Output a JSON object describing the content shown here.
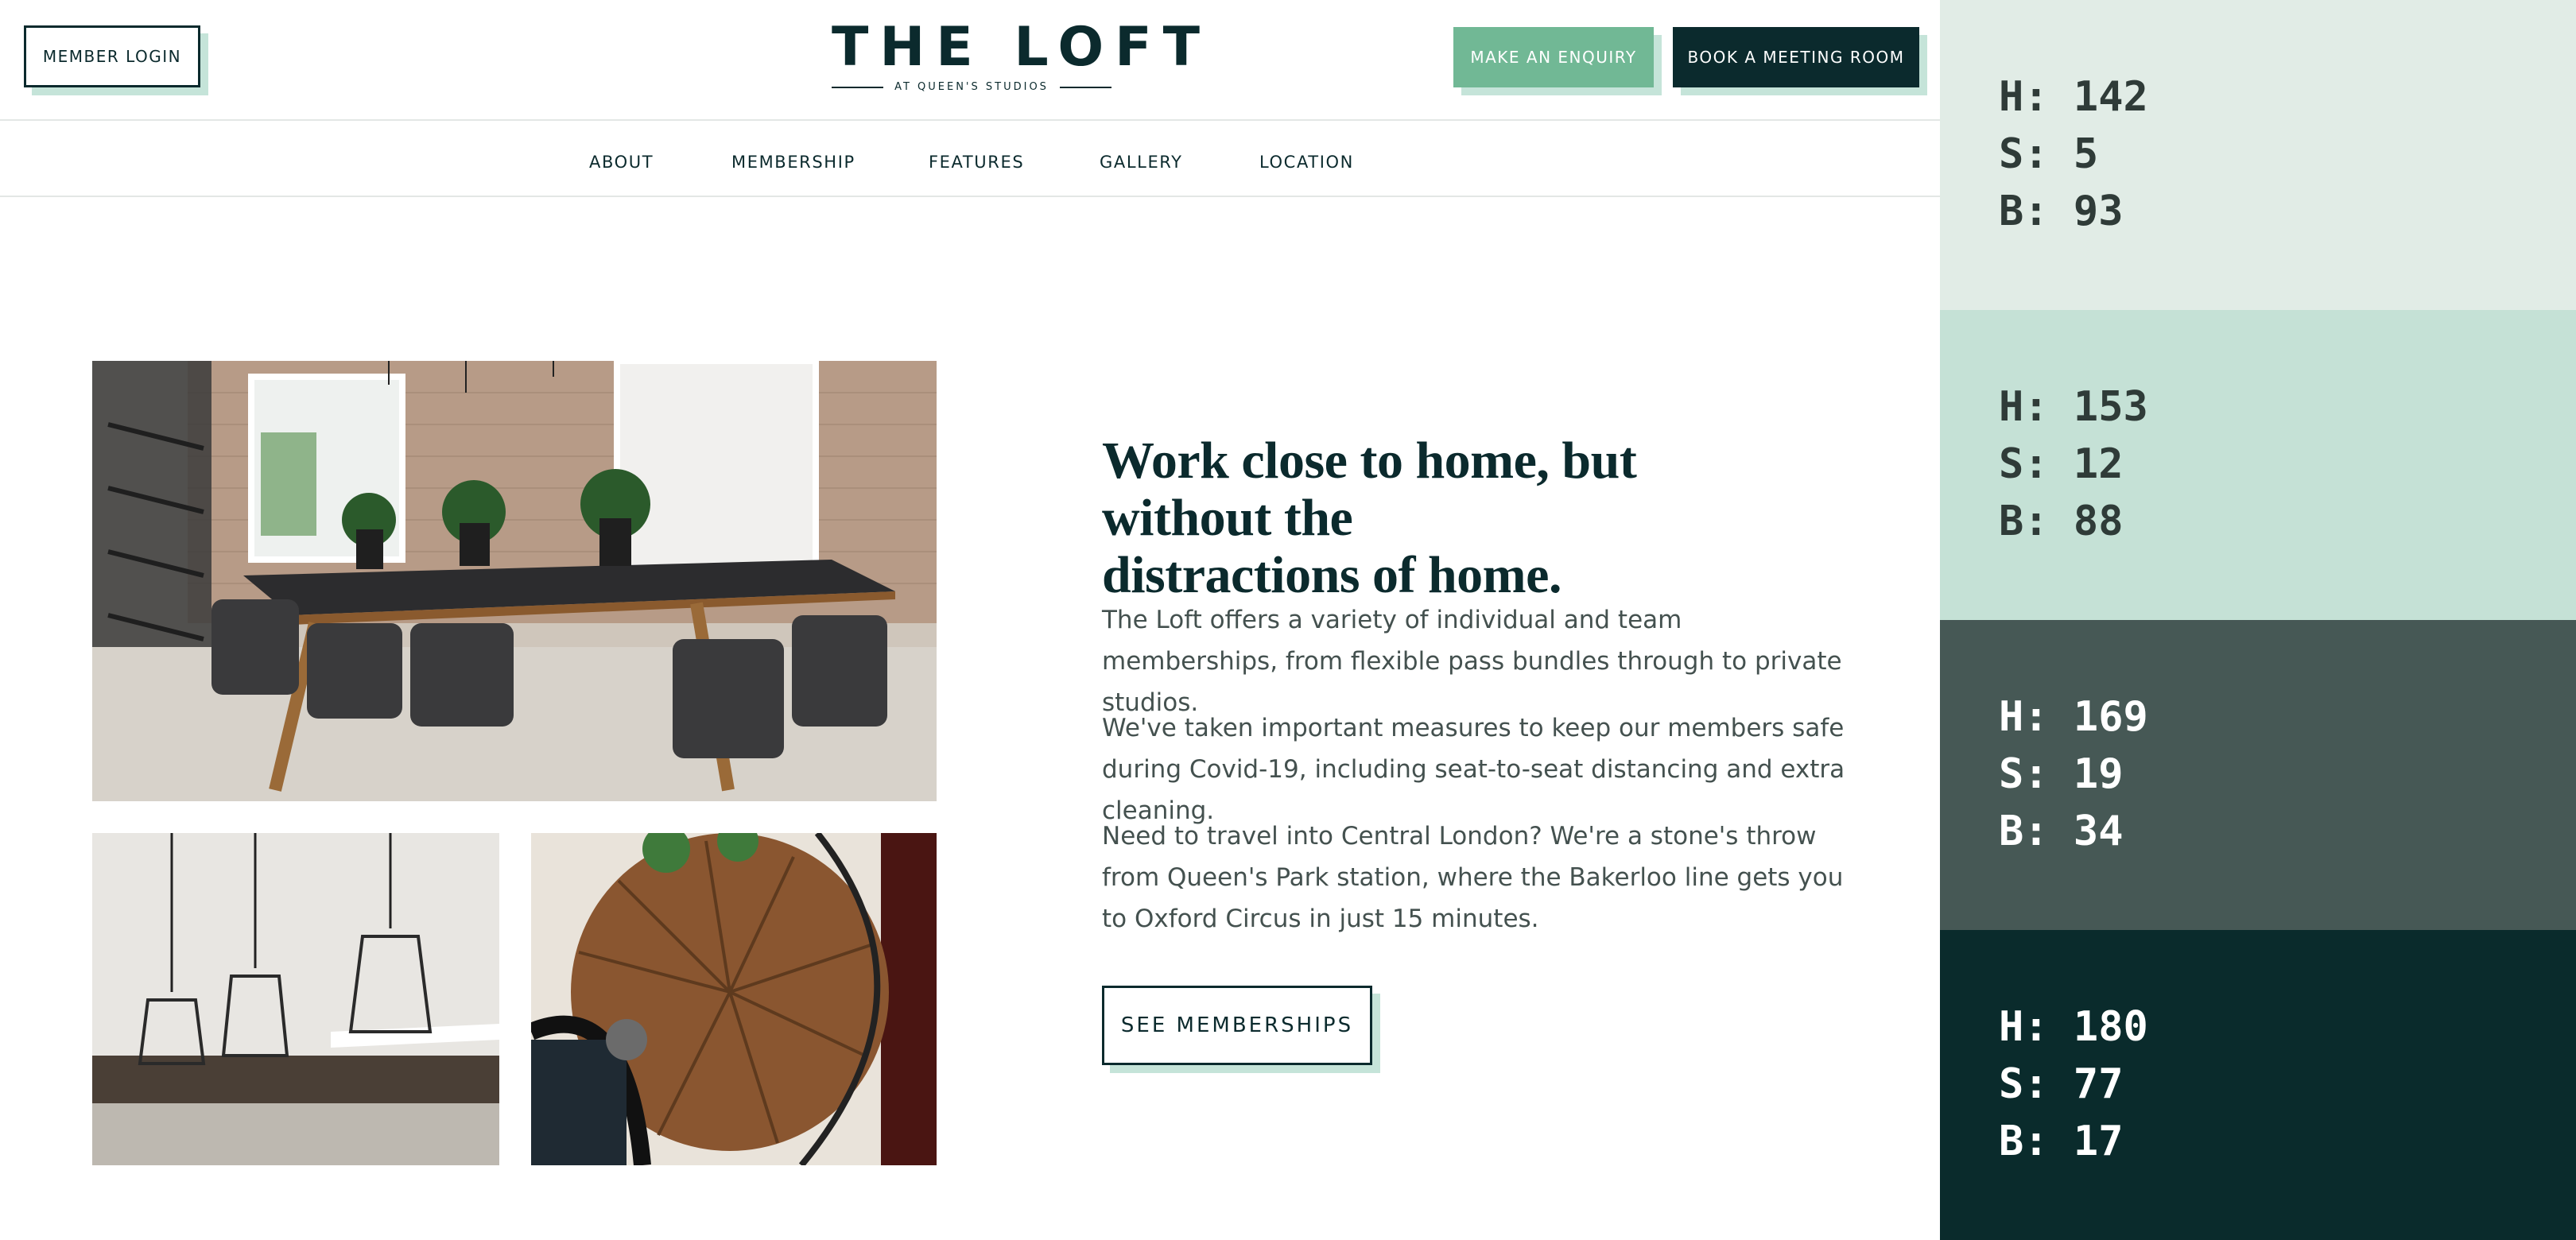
{
  "header": {
    "member_login": "MEMBER LOGIN",
    "logo_title": "THE LOFT",
    "logo_subtitle": "AT QUEEN'S STUDIOS",
    "enquiry": "MAKE AN ENQUIRY",
    "book_room": "BOOK A MEETING ROOM"
  },
  "nav": {
    "items": [
      "ABOUT",
      "MEMBERSHIP",
      "FEATURES",
      "GALLERY",
      "LOCATION"
    ]
  },
  "content": {
    "headline_line1": "Work close to home, but without the",
    "headline_line2": "distractions of home.",
    "paragraph1": "The Loft offers a variety of individual and team memberships, from flexible pass bundles through to private studios.",
    "paragraph2": "We've taken important measures to keep our members safe during Covid-19, including seat-to-seat distancing and extra cleaning.",
    "paragraph3": "Need to travel into Central London? We're a stone's throw from Queen's Park station, where the Bakerloo line gets you to Oxford Circus in just 15 minutes.",
    "cta": "SEE MEMBERSHIPS"
  },
  "palette": [
    {
      "h": "H: 142",
      "s": "S: 5",
      "b": "B: 93",
      "bg": "#e1ece6",
      "fg": "#2f3b38"
    },
    {
      "h": "H: 153",
      "s": "S: 12",
      "b": "B: 88",
      "bg": "#c5e1d6",
      "fg": "#2f3b38"
    },
    {
      "h": "H: 169",
      "s": "S: 19",
      "b": "B: 34",
      "bg": "#465855",
      "fg": "#ffffff"
    },
    {
      "h": "H: 180",
      "s": "S: 77",
      "b": "B: 17",
      "bg": "#0a2b2c",
      "fg": "#ffffff"
    }
  ],
  "colors": {
    "brand_dark": "#0b2a2d",
    "brand_green": "#71b895",
    "shadow_mint": "#c5e4d9"
  }
}
